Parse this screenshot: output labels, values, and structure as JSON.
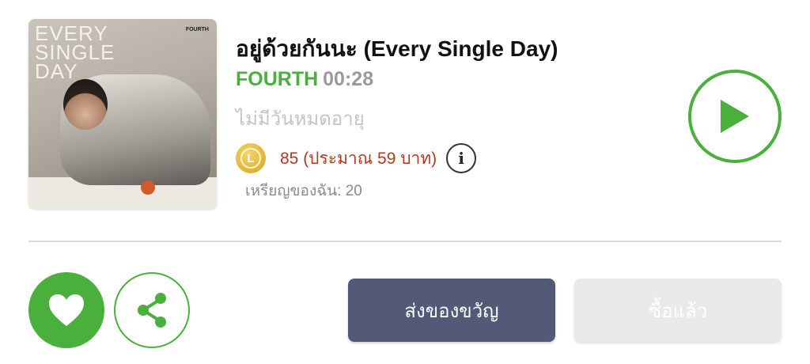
{
  "cover": {
    "title_text": "EVERY\nSINGLE\nDAY",
    "brand_text": "FOURTH"
  },
  "song": {
    "title": "อยู่ด้วยกันนะ (Every Single Day)",
    "artist": "FOURTH",
    "duration": "00:28",
    "album": "ไม่มีวันหมดอายุ"
  },
  "price": {
    "coin_letter": "L",
    "text": "85 (ประมาณ 59 บาท)",
    "info_icon": "i"
  },
  "wallet": {
    "my_coins": "เหรียญของฉัน: 20"
  },
  "actions": {
    "gift_label": "ส่งของขวัญ",
    "bought_label": "ซื้อแล้ว"
  },
  "colors": {
    "accent_green": "#4ab03c",
    "price_red": "#b23a22",
    "gift_button_bg": "#525a78",
    "disabled_button_bg": "#e9e9e9"
  },
  "icons": {
    "play": "play-icon",
    "like": "heart-icon",
    "share": "share-icon",
    "info": "info-icon",
    "coin": "coin-icon"
  }
}
